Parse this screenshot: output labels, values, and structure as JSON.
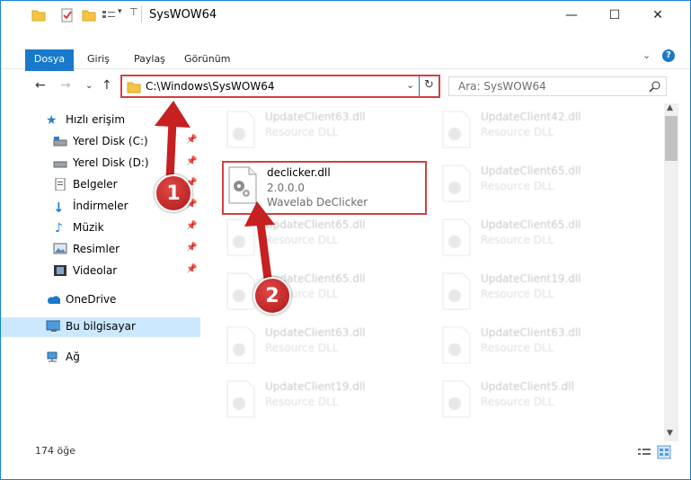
{
  "window": {
    "title": "SysWOW64",
    "controls": {
      "minimize": "—",
      "maximize": "☐",
      "close": "✕"
    }
  },
  "ribbon": {
    "tabs": [
      "Dosya",
      "Giriş",
      "Paylaş",
      "Görünüm"
    ]
  },
  "nav": {
    "address": "C:\\Windows\\SysWOW64",
    "search_placeholder": "Ara: SysWOW64"
  },
  "sidebar": {
    "items": [
      {
        "label": "Hızlı erişim",
        "icon": "star-icon",
        "pinned": false
      },
      {
        "label": "Yerel Disk (C:)",
        "icon": "drive-icon",
        "pinned": true
      },
      {
        "label": "Yerel Disk (D:)",
        "icon": "drive-icon",
        "pinned": true
      },
      {
        "label": "Belgeler",
        "icon": "document-icon",
        "pinned": true
      },
      {
        "label": "İndirmeler",
        "icon": "download-icon",
        "pinned": true
      },
      {
        "label": "Müzik",
        "icon": "music-icon",
        "pinned": true
      },
      {
        "label": "Resimler",
        "icon": "picture-icon",
        "pinned": true
      },
      {
        "label": "Videolar",
        "icon": "video-icon",
        "pinned": true
      },
      {
        "label": "OneDrive",
        "icon": "cloud-icon",
        "pinned": false
      },
      {
        "label": "Bu bilgisayar",
        "icon": "computer-icon",
        "pinned": false,
        "selected": true
      },
      {
        "label": "Ağ",
        "icon": "network-icon",
        "pinned": false
      }
    ]
  },
  "files": {
    "left": [
      {
        "name": "UpdateClient63.dll",
        "line2": "Resource DLL",
        "line3": ""
      },
      {
        "name": "declicker.dll",
        "line2": "2.0.0.0",
        "line3": "Wavelab DeClicker",
        "highlighted": true
      },
      {
        "name": "UpdateClient65.dll",
        "line2": "Resource DLL",
        "line3": ""
      },
      {
        "name": "UpdateClient65.dll",
        "line2": "Resource DLL",
        "line3": ""
      },
      {
        "name": "UpdateClient63.dll",
        "line2": "Resource DLL",
        "line3": ""
      },
      {
        "name": "UpdateClient19.dll",
        "line2": "Resource DLL",
        "line3": ""
      }
    ],
    "right": [
      {
        "name": "UpdateClient42.dll",
        "line2": "Resource DLL"
      },
      {
        "name": "UpdateClient65.dll",
        "line2": "Resource DLL"
      },
      {
        "name": "UpdateClient65.dll",
        "line2": "Resource DLL"
      },
      {
        "name": "UpdateClient19.dll",
        "line2": "Resource DLL"
      },
      {
        "name": "UpdateClient63.dll",
        "line2": "Resource DLL"
      },
      {
        "name": "UpdateClient5.dll",
        "line2": "Resource DLL"
      }
    ]
  },
  "status": {
    "count": "174 öğe"
  },
  "annotations": {
    "step1": "1",
    "step2": "2",
    "color": "#d24040"
  }
}
